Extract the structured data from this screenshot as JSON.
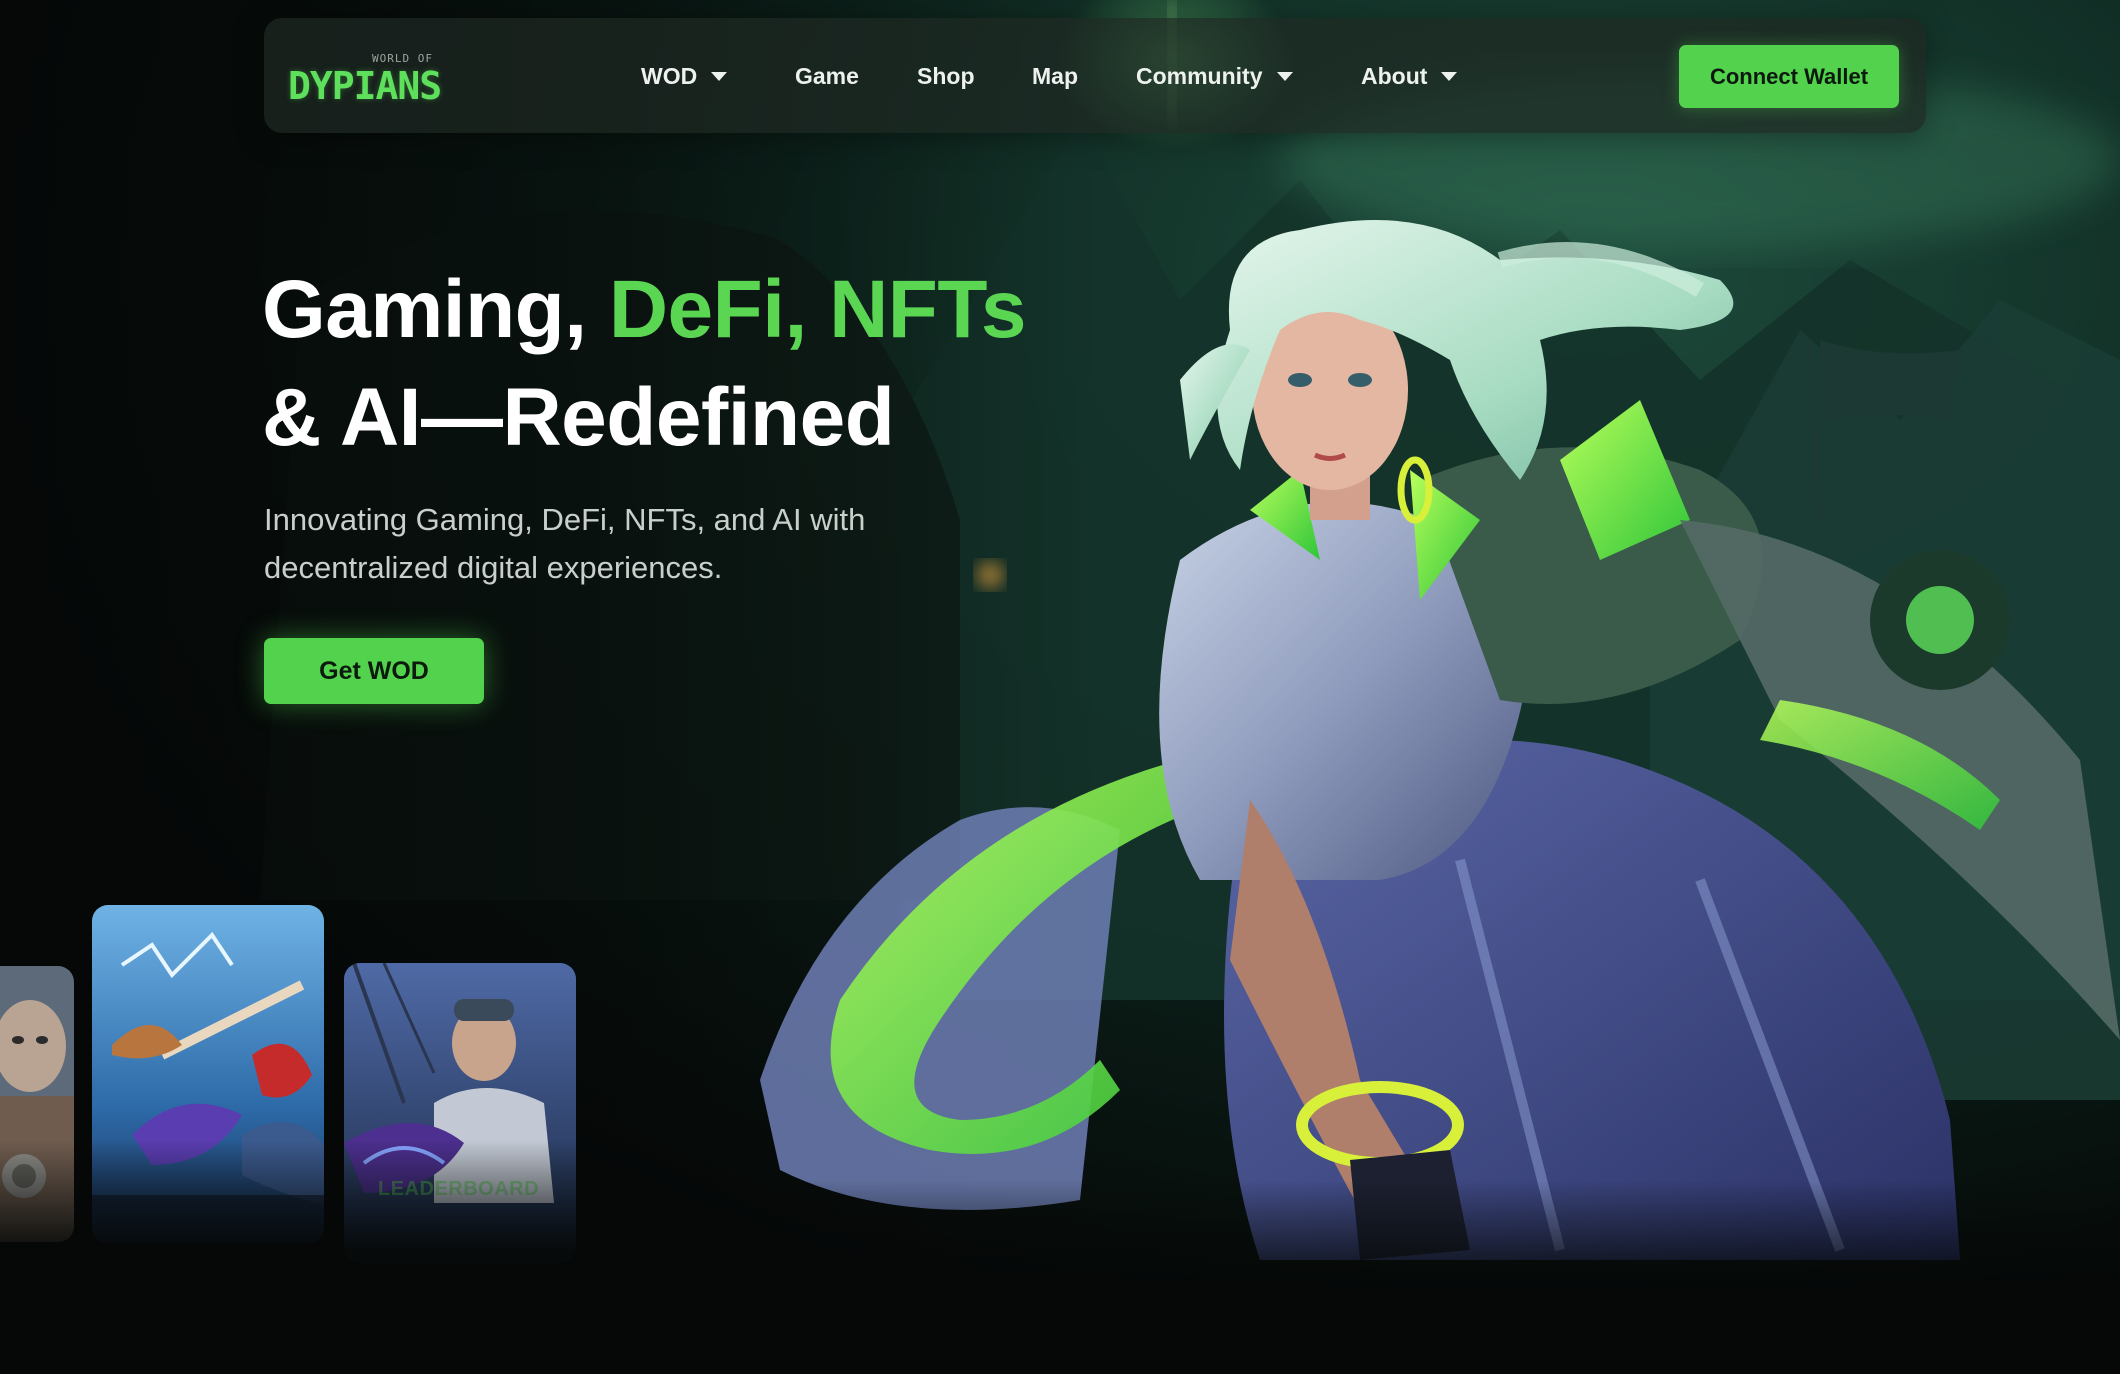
{
  "brand": {
    "logo_small": "WORLD OF",
    "logo_name": "DYPIANS"
  },
  "nav": {
    "items": [
      {
        "label": "WOD",
        "dropdown": true
      },
      {
        "label": "Game",
        "dropdown": false
      },
      {
        "label": "Shop",
        "dropdown": false
      },
      {
        "label": "Map",
        "dropdown": false
      },
      {
        "label": "Community",
        "dropdown": true
      },
      {
        "label": "About",
        "dropdown": true
      }
    ],
    "connect_label": "Connect Wallet"
  },
  "hero": {
    "title_part1": "Gaming, ",
    "title_part2": "DeFi, NFTs",
    "title_line2": "& AI—Redefined",
    "subtitle": "Innovating Gaming, DeFi, NFTs, and AI with decentralized digital experiences.",
    "cta_label": "Get WOD"
  },
  "cards": {
    "right_label": "LEADERBOARD"
  },
  "colors": {
    "accent": "#52d24d",
    "background": "#050807",
    "nav_bg": "#1e2822"
  },
  "icons": [
    "chevron-down-icon"
  ]
}
